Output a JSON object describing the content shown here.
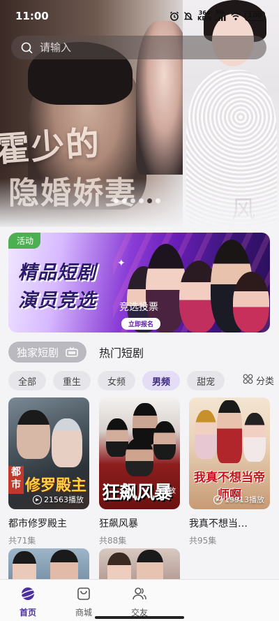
{
  "status_bar": {
    "time": "11:00",
    "net_speed_value": "364",
    "net_speed_unit": "KB/s",
    "signal": "5G",
    "battery": "100"
  },
  "search": {
    "placeholder": "请输入"
  },
  "hero": {
    "calligraphy_line1": "霍少的",
    "calligraphy_line2": "隐婚娇妻",
    "bride_text": "风",
    "carousel_dots": 6,
    "active_dot": 4
  },
  "promo": {
    "tag": "活动",
    "title_line1": "精品短剧",
    "title_line2": "演员竞选",
    "vote_text": "竞选投票",
    "signup_button": "立即报名"
  },
  "category_tabs": {
    "active": "独家短剧",
    "inactive": "热门短剧"
  },
  "filter_chips": [
    "全部",
    "重生",
    "女频",
    "男频",
    "甜宠"
  ],
  "active_chip": "男频",
  "classify_label": "分类",
  "dramas": [
    {
      "title": "都市修罗殿主",
      "episodes": "共71集",
      "plays": "21563播放",
      "poster_text": "修罗殿主",
      "poster_side": "都市"
    },
    {
      "title": "狂飙风暴",
      "episodes": "共88集",
      "plays": "",
      "poster_text": "狂飙风暴",
      "poster_sub": "播放"
    },
    {
      "title": "我真不想当…",
      "episodes": "共95集",
      "plays": "19913播放",
      "poster_text": "我真不想当帝师啊"
    }
  ],
  "bottom_nav": [
    {
      "label": "首页",
      "icon": "home-planet-icon",
      "active": true
    },
    {
      "label": "商城",
      "icon": "shopping-bag-icon",
      "active": false
    },
    {
      "label": "交友",
      "icon": "friends-icon",
      "active": false
    }
  ],
  "colors": {
    "accent": "#4b2fa0",
    "promo_tag": "#4caf50",
    "chip_active_bg": "#e4ddf5"
  }
}
